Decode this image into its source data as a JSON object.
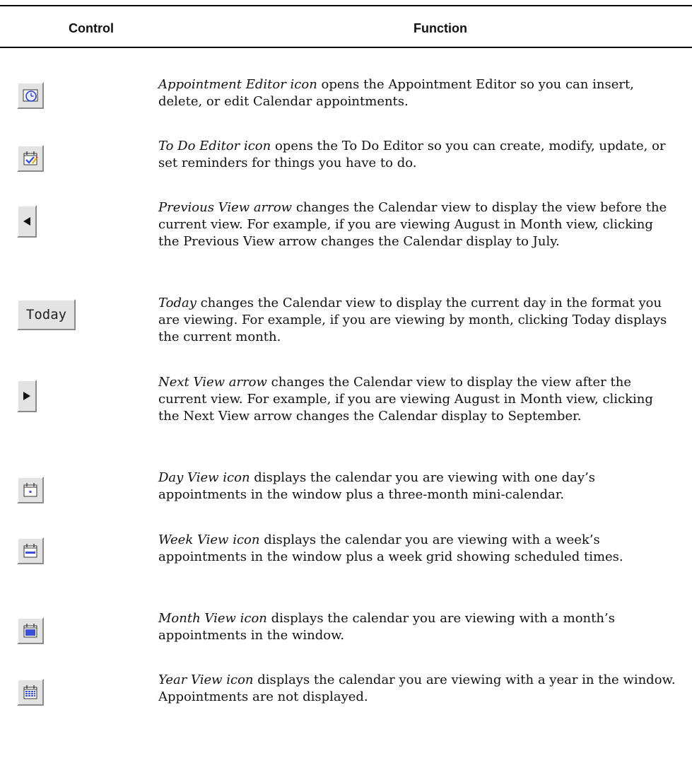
{
  "header": {
    "control": "Control",
    "function": "Function"
  },
  "rows": [
    {
      "icon": "appointment-editor-icon",
      "term": "Appointment Editor icon",
      "text": " opens the Appointment Editor so you can insert, delete, or edit Calendar appointments."
    },
    {
      "icon": "todo-editor-icon",
      "term": "To Do Editor icon",
      "text": " opens the To Do Editor so you can create, modify, update, or set reminders for things you have to do."
    },
    {
      "icon": "previous-arrow-icon",
      "term": "Previous View arrow",
      "text": " changes the Calendar view to display the view before the current view. For example, if you are viewing August in Month view, clicking the Previous View arrow changes the Calendar display to July."
    },
    {
      "icon": "today-button",
      "button_label": "Today",
      "term": "Today",
      "text": " changes the Calendar view to display the current day in the format you are viewing. For example, if you are viewing by month, clicking Today displays the current month."
    },
    {
      "icon": "next-arrow-icon",
      "term": "Next View arrow",
      "text": " changes the Calendar view to display the view after the current view. For example, if you are viewing August in Month view, clicking the Next View arrow changes the Calendar display to September."
    },
    {
      "icon": "day-view-icon",
      "term": "Day View icon",
      "text": " displays the calendar you are viewing with one day’s appointments in the window plus a three-month mini-calendar."
    },
    {
      "icon": "week-view-icon",
      "term": "Week View icon",
      "text": " displays the calendar you are viewing with a week’s appointments in the window plus a week grid showing scheduled times."
    },
    {
      "icon": "month-view-icon",
      "term": "Month View icon",
      "text": " displays the calendar you are viewing with a month’s appointments in the window."
    },
    {
      "icon": "year-view-icon",
      "term": "Year View icon",
      "text": " displays the calendar you are viewing with a year in the window. Appointments are not displayed."
    }
  ]
}
